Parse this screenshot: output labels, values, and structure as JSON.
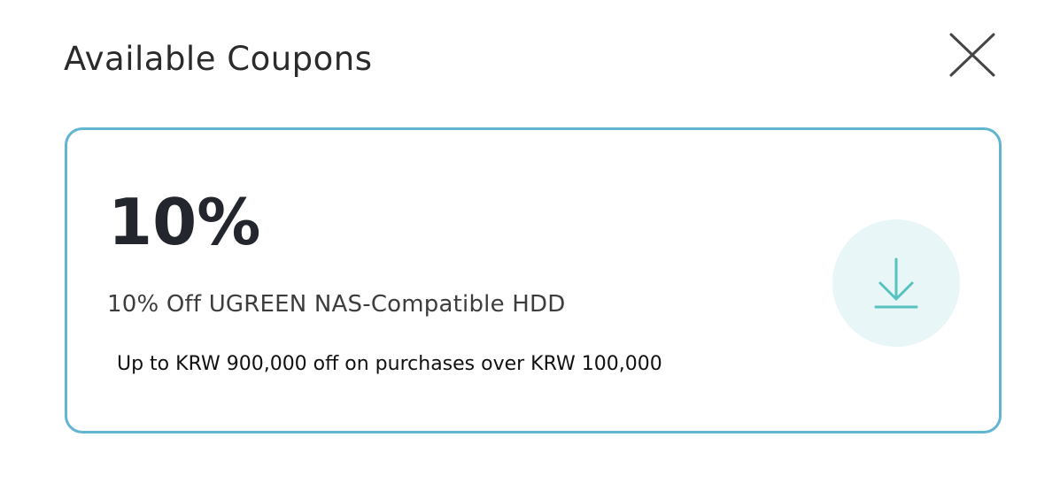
{
  "dialog": {
    "title": "Available Coupons",
    "close_icon": "close-icon"
  },
  "coupons": [
    {
      "discount": "10%",
      "name": "10% Off UGREEN NAS-Compatible HDD",
      "condition": "Up to KRW 900,000 off on purchases over KRW 100,000",
      "action_icon": "download-icon"
    }
  ],
  "colors": {
    "card_border": "#62b5d1",
    "download_circle": "#e8f6f7",
    "download_icon": "#57c2c0"
  }
}
